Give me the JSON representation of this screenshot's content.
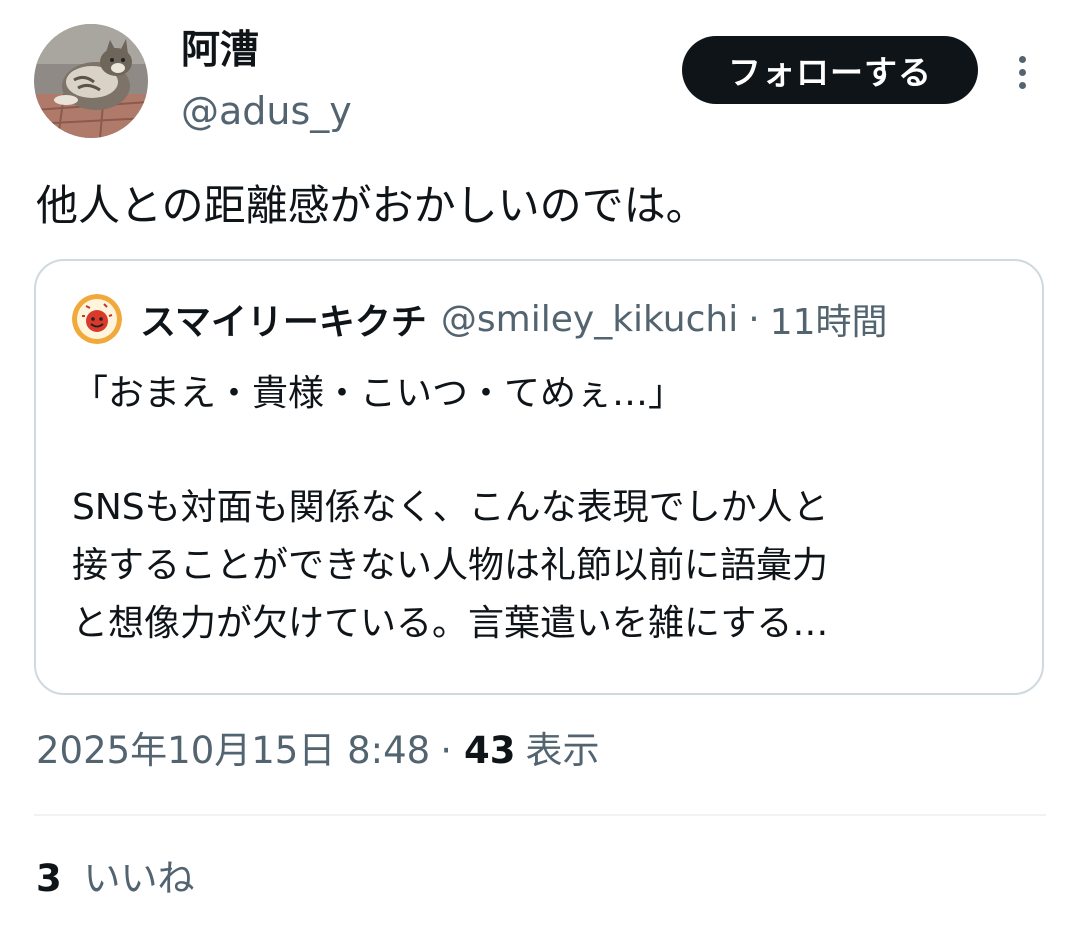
{
  "author": {
    "display_name": "阿漕",
    "handle": "@adus_y",
    "avatar_icon": "cat-photo-avatar"
  },
  "follow_button": {
    "label": "フォローする"
  },
  "more_menu": {
    "icon": "more-vertical-icon"
  },
  "tweet": {
    "text": "他人との距離感がおかしいのでは。"
  },
  "quote": {
    "avatar_icon": "smiley-kikuchi-avatar",
    "name": "スマイリーキクチ",
    "handle": "@smiley_kikuchi",
    "separator": "·",
    "time": "11時間",
    "lines": [
      "「おまえ・貴様・こいつ・てめぇ…」",
      "",
      "SNSも対面も関係なく、こんな表現でしか人と",
      "接することができない人物は礼節以前に語彙力",
      "と想像力が欠けている。言葉遣いを雑にする…"
    ]
  },
  "meta": {
    "datetime": "2025年10月15日 8:48",
    "separator": "·",
    "views_count": "43",
    "views_label": "表示"
  },
  "likes": {
    "count": "3",
    "label": "いいね"
  },
  "colors": {
    "text_primary": "#0f1419",
    "text_secondary": "#536471",
    "border": "#cfd9de",
    "button_bg": "#0f1419",
    "button_text": "#ffffff"
  }
}
